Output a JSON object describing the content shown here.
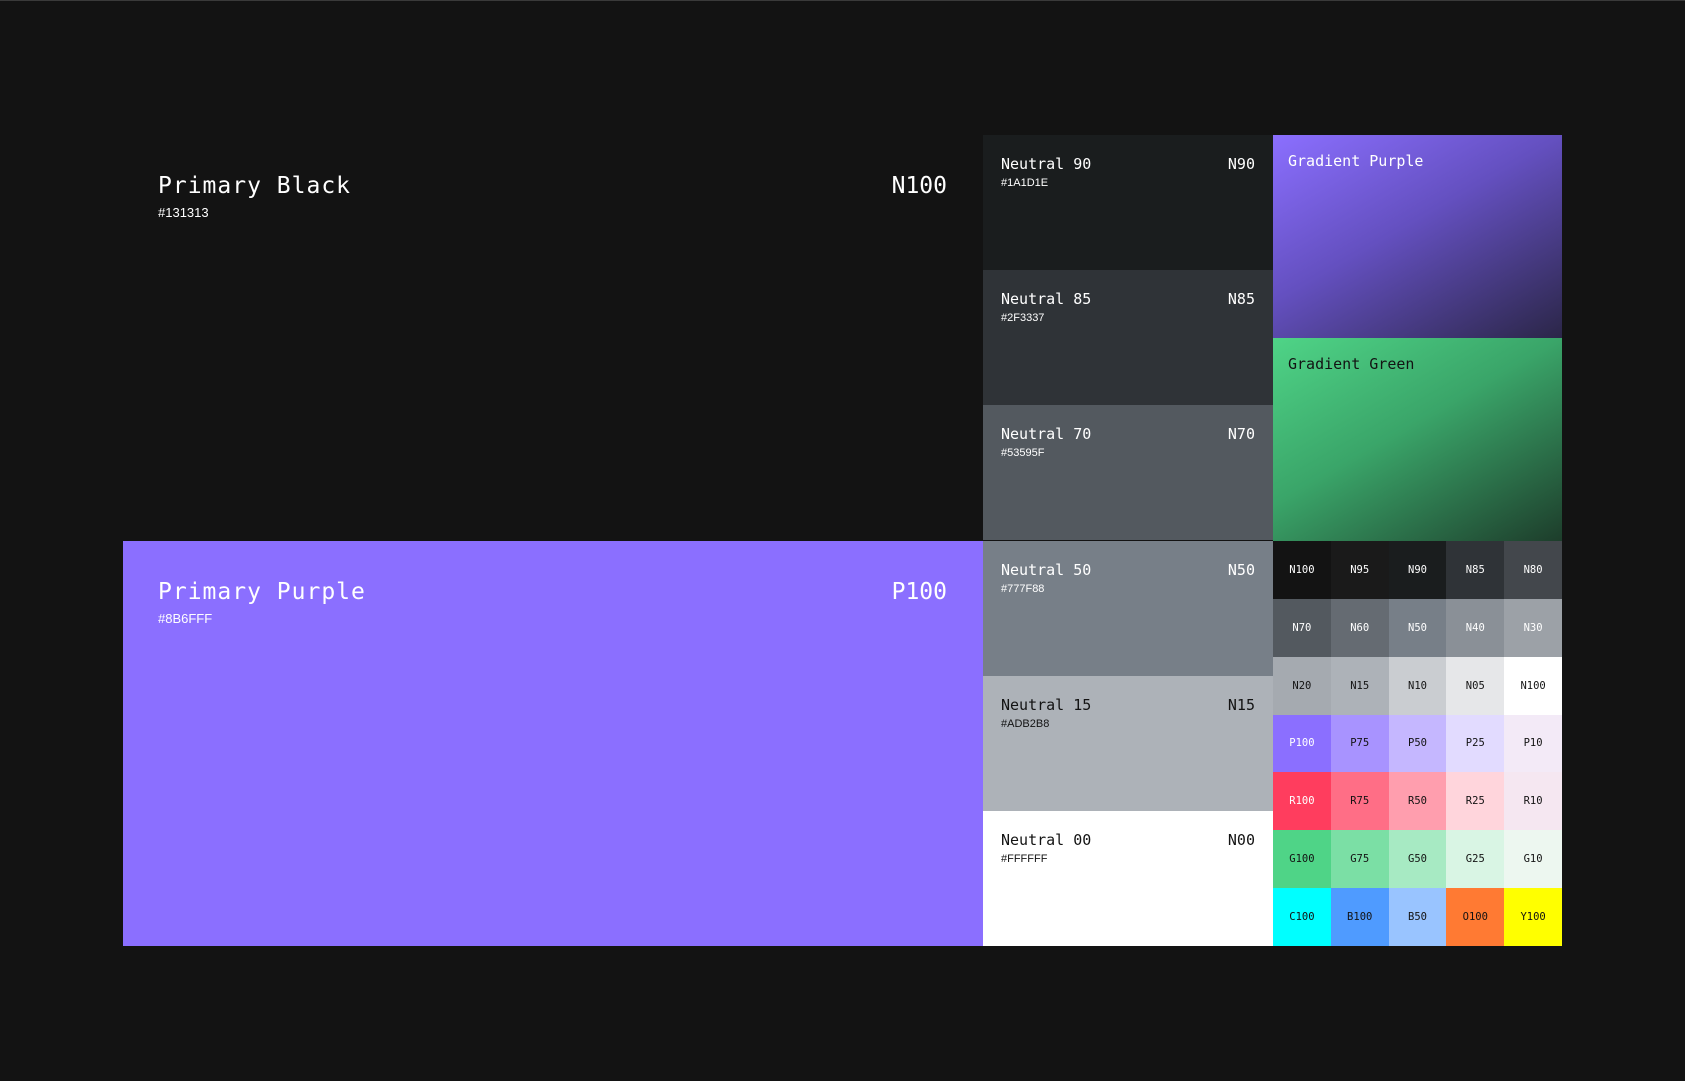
{
  "primary": [
    {
      "name": "Primary Black",
      "hex": "#131313",
      "code": "N100",
      "bg": "#131313",
      "fg": "#FFFFFF"
    },
    {
      "name": "Primary Purple",
      "hex": "#8B6FFF",
      "code": "P100",
      "bg": "#8B6FFF",
      "fg": "#FFFFFF"
    }
  ],
  "neutrals": [
    {
      "name": "Neutral 90",
      "hex": "#1A1D1E",
      "code": "N90",
      "bg": "#1A1D1E",
      "fg": "#FFFFFF"
    },
    {
      "name": "Neutral 85",
      "hex": "#2F3337",
      "code": "N85",
      "bg": "#2F3337",
      "fg": "#FFFFFF"
    },
    {
      "name": "Neutral 70",
      "hex": "#53595F",
      "code": "N70",
      "bg": "#53595F",
      "fg": "#FFFFFF"
    },
    {
      "name": "Neutral 50",
      "hex": "#777F88",
      "code": "N50",
      "bg": "#777F88",
      "fg": "#FFFFFF"
    },
    {
      "name": "Neutral 15",
      "hex": "#ADB2B8",
      "code": "N15",
      "bg": "#ADB2B8",
      "fg": "#131313"
    },
    {
      "name": "Neutral 00",
      "hex": "#FFFFFF",
      "code": "N00",
      "bg": "#FFFFFF",
      "fg": "#131313"
    }
  ],
  "gradients": [
    {
      "name": "Gradient Purple"
    },
    {
      "name": "Gradient Green"
    }
  ],
  "swatches": [
    {
      "label": "N100",
      "bg": "#131313",
      "fg": "#FFFFFF"
    },
    {
      "label": "N95",
      "bg": "#1A1A1A",
      "fg": "#FFFFFF"
    },
    {
      "label": "N90",
      "bg": "#1A1D1E",
      "fg": "#FFFFFF"
    },
    {
      "label": "N85",
      "bg": "#2F3337",
      "fg": "#FFFFFF"
    },
    {
      "label": "N80",
      "bg": "#43474C",
      "fg": "#FFFFFF"
    },
    {
      "label": "N70",
      "bg": "#53595F",
      "fg": "#FFFFFF"
    },
    {
      "label": "N60",
      "bg": "#656B72",
      "fg": "#FFFFFF"
    },
    {
      "label": "N50",
      "bg": "#777F88",
      "fg": "#FFFFFF"
    },
    {
      "label": "N40",
      "bg": "#8A9097",
      "fg": "#FFFFFF"
    },
    {
      "label": "N30",
      "bg": "#9CA1A7",
      "fg": "#FFFFFF"
    },
    {
      "label": "N20",
      "bg": "#A5AAB0",
      "fg": "#131313"
    },
    {
      "label": "N15",
      "bg": "#ADB2B8",
      "fg": "#131313"
    },
    {
      "label": "N10",
      "bg": "#CACDD1",
      "fg": "#131313"
    },
    {
      "label": "N05",
      "bg": "#E6E7E9",
      "fg": "#131313"
    },
    {
      "label": "N100",
      "bg": "#FFFFFF",
      "fg": "#131313"
    },
    {
      "label": "P100",
      "bg": "#8B6FFF",
      "fg": "#FFFFFF"
    },
    {
      "label": "P75",
      "bg": "#A893FF",
      "fg": "#131313"
    },
    {
      "label": "P50",
      "bg": "#C5B7FF",
      "fg": "#131313"
    },
    {
      "label": "P25",
      "bg": "#E2DBFF",
      "fg": "#131313"
    },
    {
      "label": "P10",
      "bg": "#F3EAF7",
      "fg": "#131313"
    },
    {
      "label": "R100",
      "bg": "#FF3D5E",
      "fg": "#FFFFFF"
    },
    {
      "label": "R75",
      "bg": "#FF6E86",
      "fg": "#131313"
    },
    {
      "label": "R50",
      "bg": "#FF9EAE",
      "fg": "#131313"
    },
    {
      "label": "R25",
      "bg": "#FFD5DC",
      "fg": "#131313"
    },
    {
      "label": "R10",
      "bg": "#F5E7F1",
      "fg": "#131313"
    },
    {
      "label": "G100",
      "bg": "#4FD487",
      "fg": "#131313"
    },
    {
      "label": "G75",
      "bg": "#7BDFA5",
      "fg": "#131313"
    },
    {
      "label": "G50",
      "bg": "#A7EAC3",
      "fg": "#131313"
    },
    {
      "label": "G25",
      "bg": "#D9F5E4",
      "fg": "#131313"
    },
    {
      "label": "G10",
      "bg": "#EDF7F0",
      "fg": "#131313"
    },
    {
      "label": "C100",
      "bg": "#00FFFF",
      "fg": "#131313"
    },
    {
      "label": "B100",
      "bg": "#4F9BFF",
      "fg": "#131313"
    },
    {
      "label": "B50",
      "bg": "#99C4FF",
      "fg": "#131313"
    },
    {
      "label": "O100",
      "bg": "#FF7A33",
      "fg": "#131313"
    },
    {
      "label": "Y100",
      "bg": "#FFFF00",
      "fg": "#131313"
    }
  ]
}
